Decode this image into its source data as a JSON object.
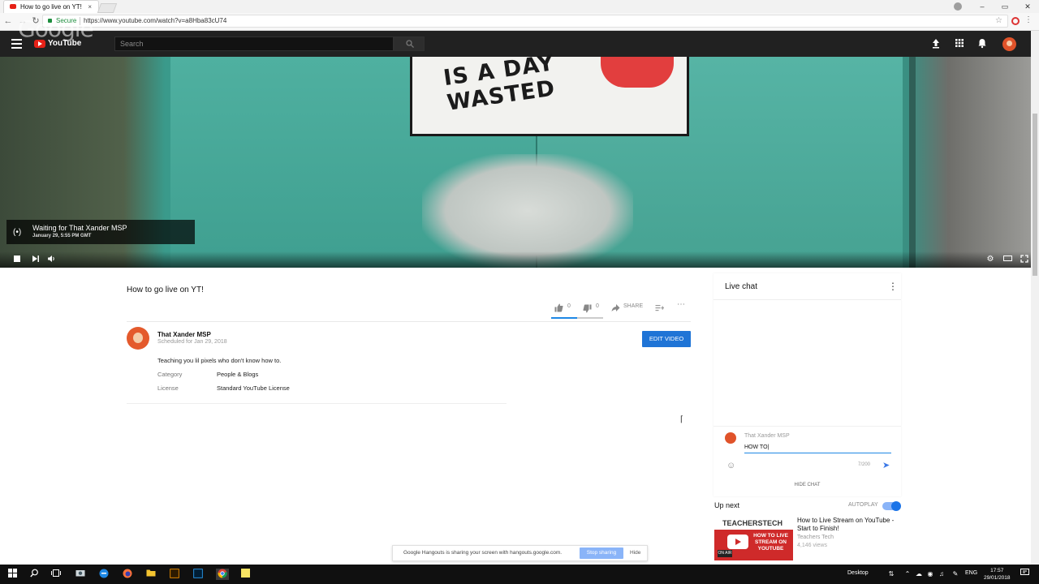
{
  "browser": {
    "tab_title": "How to go live on YT!",
    "tab_close": "×",
    "secure_label": "Secure",
    "url": "https://www.youtube.com/watch?v=a8Hba83cU74",
    "window_buttons": [
      "–",
      "▭",
      "✕"
    ]
  },
  "youtube": {
    "watermark": "Google",
    "logo_text": "YouTube",
    "search_placeholder": "Search"
  },
  "player": {
    "sign_text": "IS A DAY WASTED",
    "live_title": "Waiting for That Xander MSP",
    "live_time": "January 29, 5:55 PM GMT"
  },
  "video": {
    "title": "How to go live on YT!",
    "likes": "0",
    "dislikes": "0",
    "share_label": "SHARE",
    "channel_name": "That Xander MSP",
    "scheduled": "Scheduled for Jan 29, 2018",
    "edit_button": "EDIT VIDEO",
    "description": "Teaching you lil pixels who don't know how to.",
    "meta": [
      {
        "key": "Category",
        "value": "People & Blogs"
      },
      {
        "key": "License",
        "value": "Standard YouTube License"
      }
    ]
  },
  "chat": {
    "title": "Live chat",
    "user": "That Xander MSP",
    "input_value": "HOW TO|",
    "char_count": "7/200",
    "hide_chat": "HIDE CHAT"
  },
  "up_next": {
    "label": "Up next",
    "autoplay_label": "AUTOPLAY",
    "autoplay_on": true,
    "video": {
      "thumb_brand": "TEACHERSTECH",
      "thumb_text": "HOW TO LIVE STREAM ON YOUTUBE",
      "thumb_badge": "ON AIR",
      "title": "How to Live Stream on YouTube - Start to Finish!",
      "channel": "Teachers Tech",
      "views": "4,146 views"
    }
  },
  "sharing_bar": {
    "message": "Google Hangouts is sharing your screen with hangouts.google.com.",
    "stop_label": "Stop sharing",
    "hide_label": "Hide"
  },
  "taskbar": {
    "desktop_label": "Desktop",
    "language": "ENG",
    "time": "17:57",
    "date": "29/01/2018"
  }
}
